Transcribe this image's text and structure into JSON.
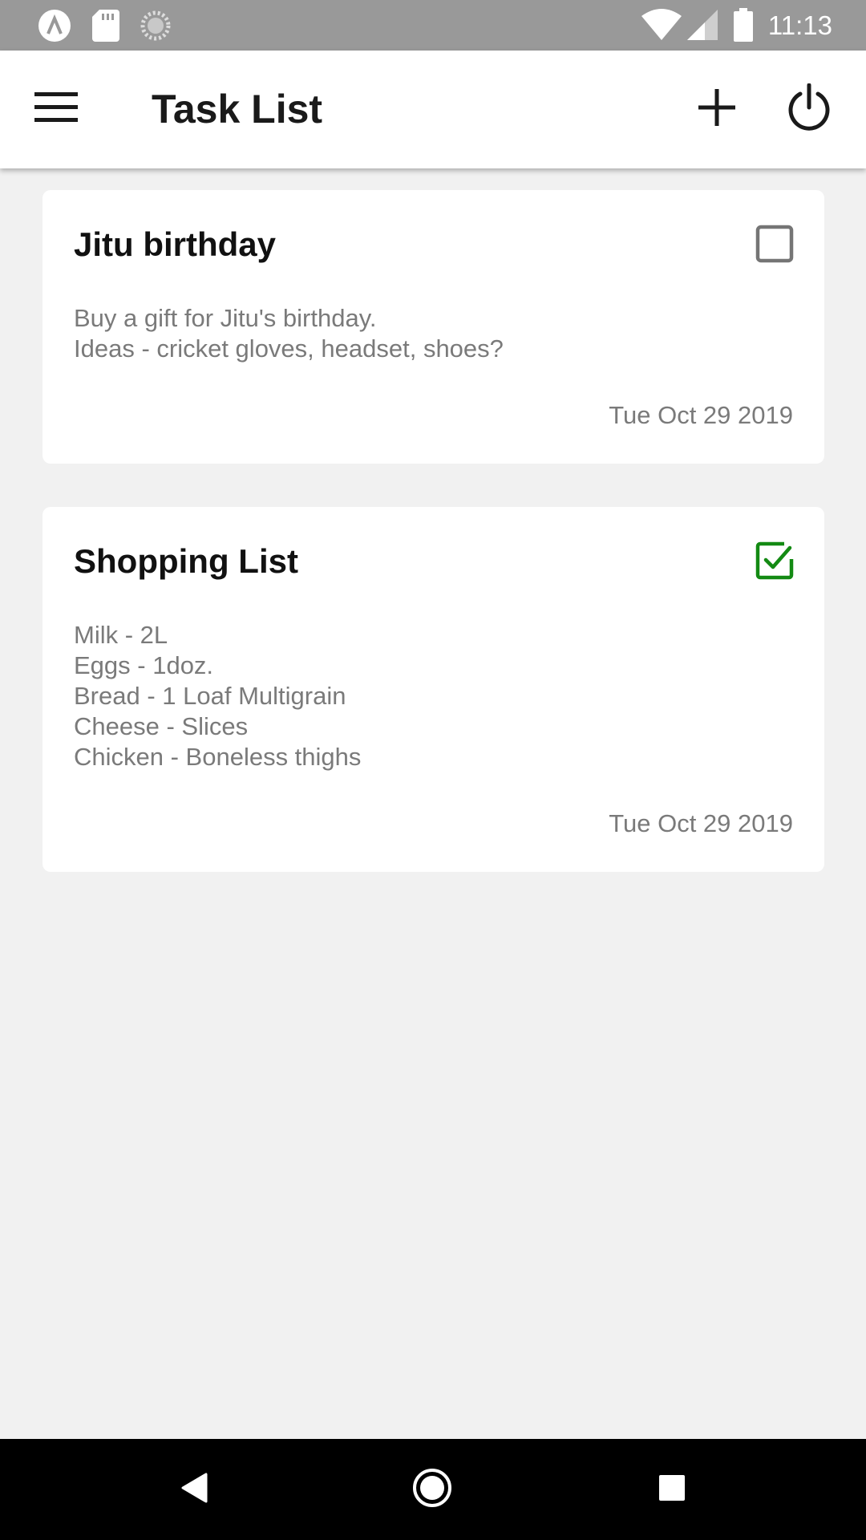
{
  "status_bar": {
    "time": "11:13",
    "icons": [
      "app-notification-icon",
      "sd-card-icon",
      "sync-icon",
      "wifi-icon",
      "signal-icon",
      "battery-icon"
    ]
  },
  "app_bar": {
    "title": "Task List",
    "icons": {
      "menu": "menu-icon",
      "add": "add-icon",
      "power": "power-icon"
    }
  },
  "tasks": [
    {
      "title": "Jitu birthday",
      "lines": [
        "Buy a gift for Jitu's birthday.",
        "Ideas - cricket gloves, headset, shoes?"
      ],
      "date": "Tue Oct 29 2019",
      "completed": false
    },
    {
      "title": "Shopping List",
      "lines": [
        "Milk - 2L",
        "Eggs - 1doz.",
        "Bread - 1 Loaf Multigrain",
        "Cheese - Slices",
        "Chicken - Boneless thighs"
      ],
      "date": "Tue Oct 29 2019",
      "completed": true
    }
  ],
  "nav_bar": {
    "icons": [
      "back-icon",
      "home-icon",
      "recents-icon"
    ]
  },
  "colors": {
    "status_bar": "#999999",
    "app_bar": "#ffffff",
    "background": "#f1f1f1",
    "checked": "#138a13",
    "unchecked": "#757575",
    "muted_text": "#7a7a7a",
    "nav_bar": "#000000"
  }
}
